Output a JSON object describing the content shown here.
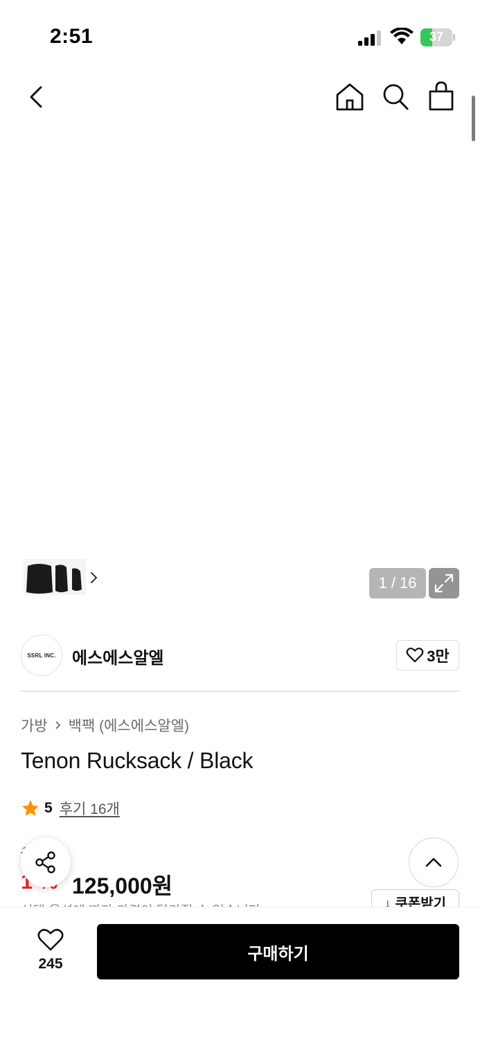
{
  "status_bar": {
    "time": "2:51",
    "battery": "37",
    "battery_level": 0.37,
    "battery_color": "#34c759"
  },
  "nav": {
    "back_icon": "chevron-left-icon",
    "home_icon": "home-icon",
    "search_icon": "search-icon",
    "cart_icon": "shopping-bag-icon"
  },
  "gallery": {
    "counter": "1 / 16",
    "expand_icon": "expand-icon"
  },
  "brand": {
    "logo_text": "SSRL INC.",
    "name": "에스에스알엘",
    "likes": "3만"
  },
  "breadcrumb": {
    "category": "가방",
    "subcategory": "백팩 (에스에스알엘)"
  },
  "product": {
    "title": "Tenon Rucksack / Black",
    "rating": "5",
    "reviews": "후기 16개",
    "original_price": "1  ,  0원",
    "discount": "1 %",
    "price": "125,000원",
    "coupon_label": "↓ 쿠폰받기",
    "notice": "선택 옵션에 따라 가격이 달라질 수 있습니다"
  },
  "bottom_bar": {
    "wish_count": "245",
    "buy_label": "구매하기"
  },
  "colors": {
    "accent": "#000000",
    "discount": "#e52929",
    "star": "#ff9100"
  }
}
